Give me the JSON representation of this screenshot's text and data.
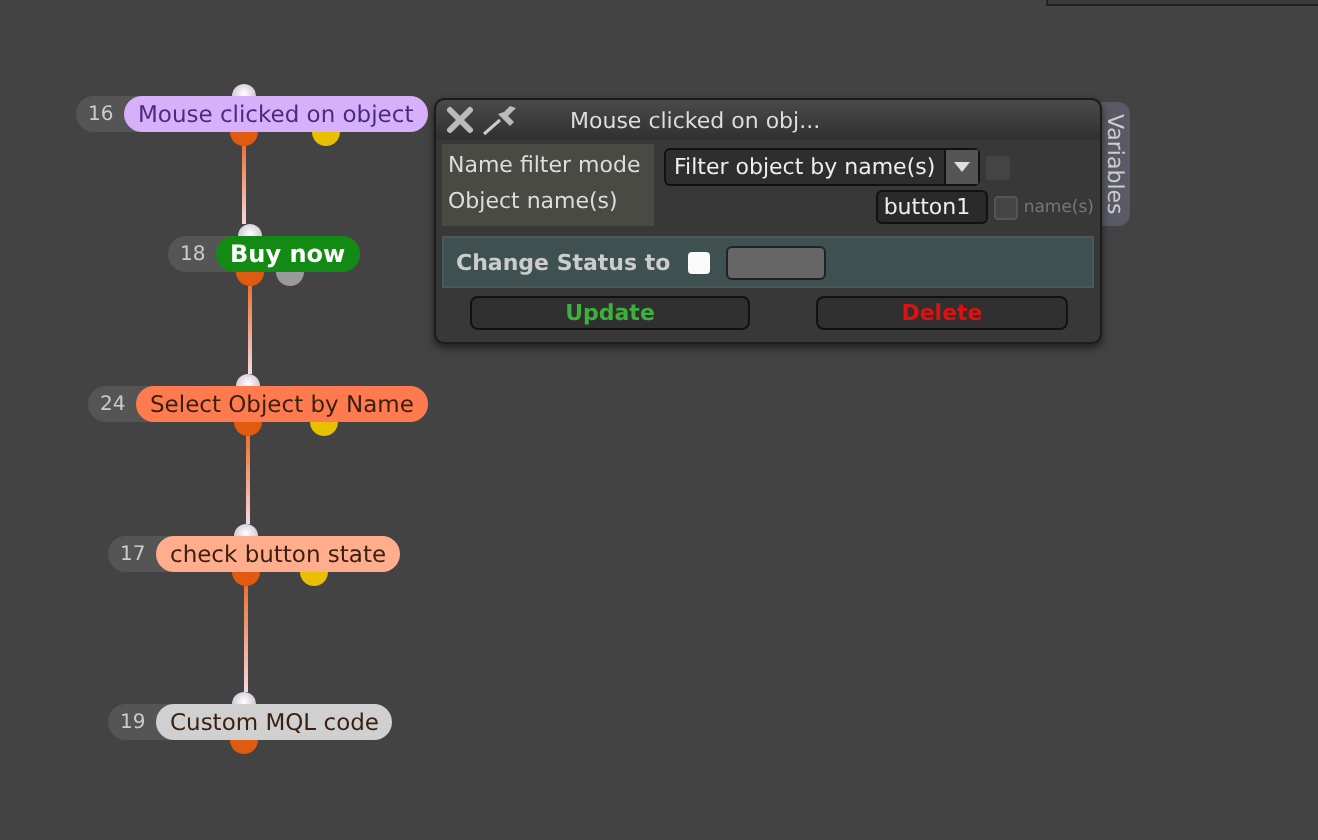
{
  "nodes": [
    {
      "number": "16",
      "label": "Mouse clicked on object",
      "kind": "event",
      "color": "#d7b0fb",
      "side_pin": {
        "color": "#e8c000"
      }
    },
    {
      "number": "18",
      "label": "Buy now",
      "kind": "button",
      "color": "#138a13",
      "side_pin": {
        "color": "#9a9a9a"
      }
    },
    {
      "number": "24",
      "label": "Select Object by Name",
      "kind": "action",
      "color": "#ff7a4f",
      "side_pin": {
        "color": "#e8c000"
      }
    },
    {
      "number": "17",
      "label": "check button state",
      "kind": "action",
      "color": "#ffad8c",
      "side_pin": {
        "color": "#e8c000"
      }
    },
    {
      "number": "19",
      "label": "Custom MQL code",
      "kind": "action",
      "color": "#d0d0d0"
    }
  ],
  "panel": {
    "title": "Mouse clicked on obj...",
    "side_tab": "Variables",
    "fields": [
      {
        "label": "Name filter mode",
        "kind": "dropdown",
        "value": "Filter object by name(s)",
        "checked": false
      },
      {
        "label": "Object name(s)",
        "kind": "text",
        "value": "button1",
        "checked": false,
        "checkbox_label": "name(s)"
      }
    ],
    "status": {
      "label": "Change Status to",
      "checked": false
    },
    "buttons": [
      {
        "label": "Update",
        "kind": "update"
      },
      {
        "label": "Delete",
        "kind": "delete"
      }
    ]
  }
}
